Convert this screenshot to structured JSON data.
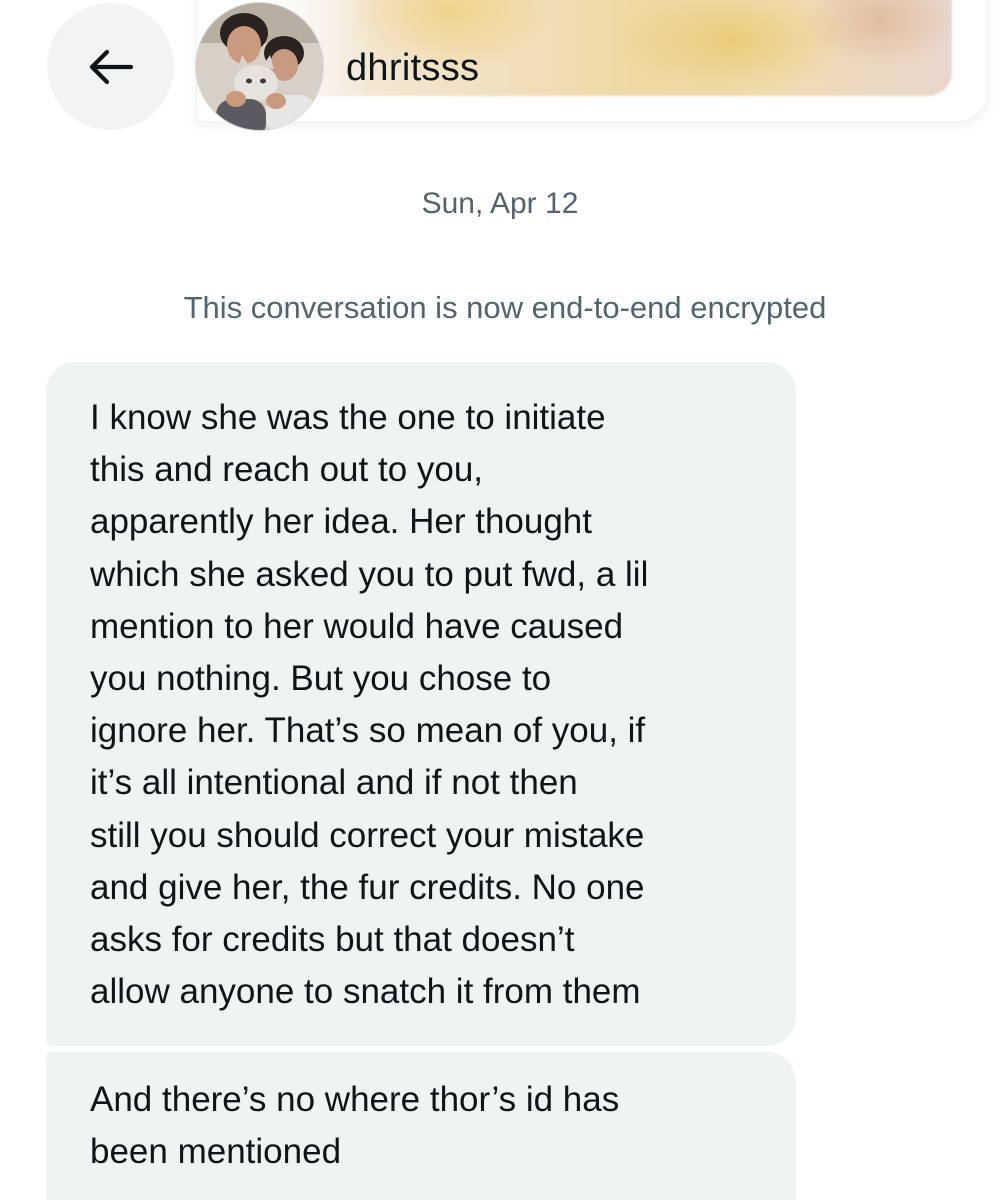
{
  "header": {
    "back_icon": "arrow-left-icon",
    "avatar_icon": "user-avatar-photo",
    "username": "dhritsss"
  },
  "conversation": {
    "date": "Sun, Apr 12",
    "encryption_notice": "This conversation is now end-to-end encrypted"
  },
  "messages": [
    {
      "lines": [
        "I know she was the one to initiate",
        "this and reach out to you,",
        "apparently her idea. Her thought",
        "which she asked you to put fwd, a lil",
        "mention to her would have caused",
        "you nothing. But you chose to",
        "ignore her. That’s so mean of you, if",
        "it’s all intentional and if not then",
        "still you should correct your mistake",
        "and give her, the fur credits. No one",
        "asks for credits but that doesn’t",
        "allow anyone to snatch it from them"
      ]
    },
    {
      "lines": [
        "And there’s no where thor’s id has",
        "been mentioned"
      ]
    }
  ],
  "colors": {
    "bubble_bg": "#eff3f4",
    "text_primary": "#0f1419",
    "text_secondary": "#536471",
    "back_button_bg": "#f2f3f4"
  }
}
